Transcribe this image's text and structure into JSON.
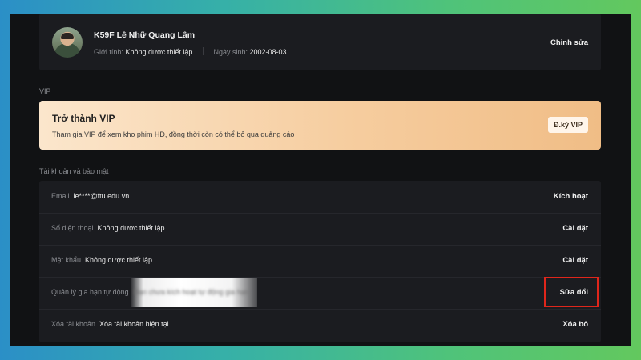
{
  "profile": {
    "name": "K59F Lê Nhữ Quang Lâm",
    "gender_label": "Giới tính:",
    "gender_value": "Không được thiết lập",
    "birth_label": "Ngày sinh:",
    "birth_value": "2002-08-03",
    "edit_label": "Chỉnh sửa"
  },
  "vip_section": {
    "label": "VIP",
    "title": "Trở thành VIP",
    "description": "Tham gia VIP để xem kho phim HD, đồng thời còn có thể bỏ qua quảng cáo",
    "button_label": "Đ.ký VIP"
  },
  "security_section": {
    "label": "Tài khoản và bảo mật",
    "rows": [
      {
        "label": "Email",
        "value": "le****@ftu.edu.vn",
        "action": "Kích hoạt"
      },
      {
        "label": "Số điện thoại",
        "value": "Không được thiết lập",
        "action": "Cài đặt"
      },
      {
        "label": "Mật khẩu",
        "value": "Không được thiết lập",
        "action": "Cài đặt"
      },
      {
        "label": "Quản lý gia hạn tự động",
        "value": "Bạn chưa kích hoạt tự động gia hạn",
        "action": "Sửa đổi"
      },
      {
        "label": "Xóa tài khoản",
        "value": "Xóa tài khoản hiện tại",
        "action": "Xóa bỏ"
      }
    ]
  },
  "colors": {
    "highlight": "#e0261b",
    "background": "#111214",
    "card": "#1b1c20"
  }
}
